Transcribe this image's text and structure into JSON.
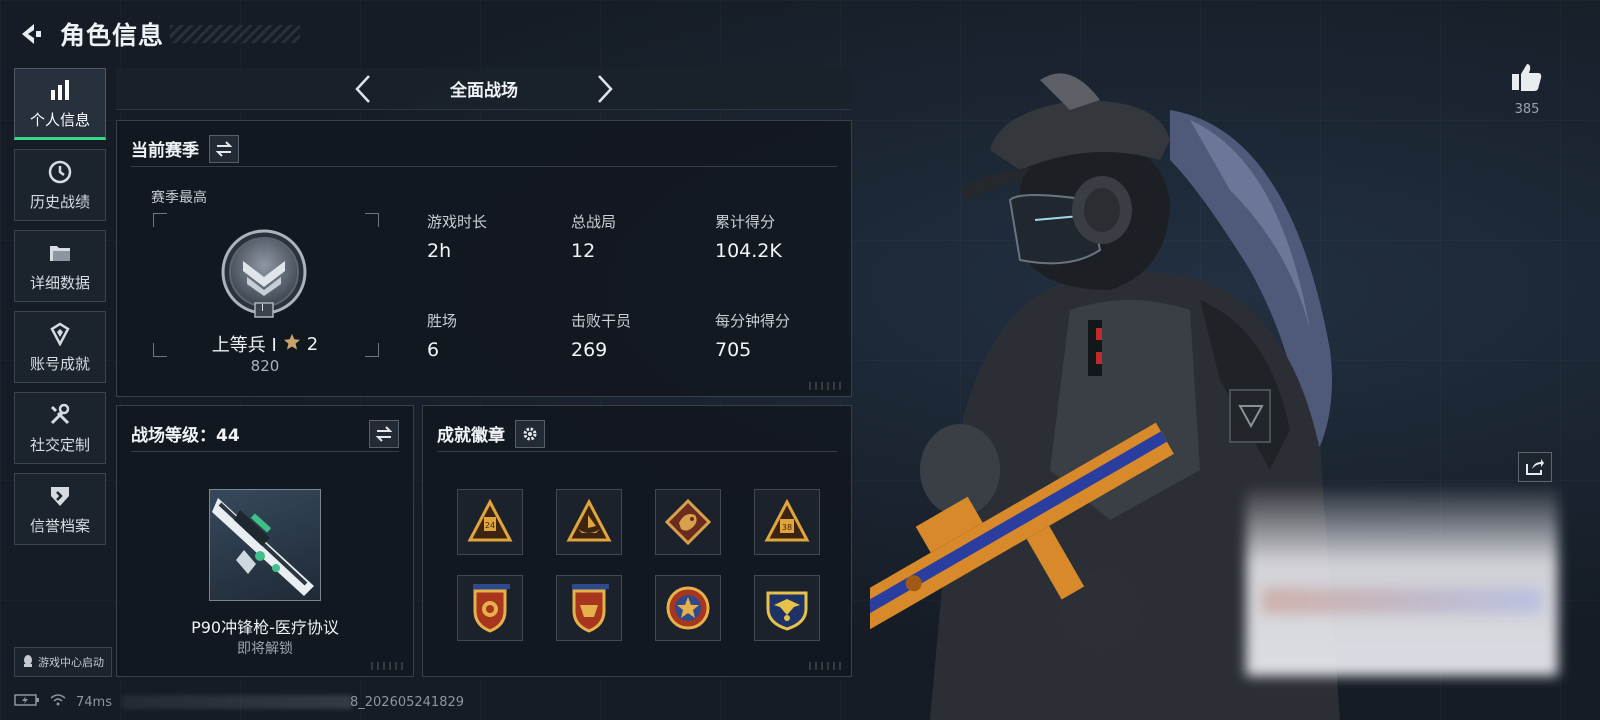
{
  "header": {
    "title": "角色信息"
  },
  "sidebar": {
    "items": [
      {
        "label": "个人信息",
        "icon": "bar-chart-icon",
        "active": true
      },
      {
        "label": "历史战绩",
        "icon": "history-icon",
        "active": false
      },
      {
        "label": "详细数据",
        "icon": "folder-icon",
        "active": false
      },
      {
        "label": "账号成就",
        "icon": "achievement-icon",
        "active": false
      },
      {
        "label": "社交定制",
        "icon": "tools-icon",
        "active": false
      },
      {
        "label": "信誉档案",
        "icon": "reputation-icon",
        "active": false
      }
    ],
    "launcher_label": "游戏中心启动"
  },
  "mode_bar": {
    "title": "全面战场"
  },
  "season_panel": {
    "title": "当前赛季",
    "best_label": "赛季最高",
    "rank_name": "上等兵 I",
    "rank_stars": "2",
    "rank_score": "820",
    "emblem_numeral": "I",
    "stats": [
      {
        "label": "游戏时长",
        "value": "2h"
      },
      {
        "label": "总战局",
        "value": "12"
      },
      {
        "label": "累计得分",
        "value": "104.2K"
      },
      {
        "label": "胜场",
        "value": "6"
      },
      {
        "label": "击败干员",
        "value": "269"
      },
      {
        "label": "每分钟得分",
        "value": "705"
      }
    ]
  },
  "level_panel": {
    "title": "战场等级：44",
    "weapon_name": "P90冲锋枪-医疗协议",
    "weapon_status": "即将解锁"
  },
  "badge_panel": {
    "title": "成就徽章",
    "badges": [
      "triangle-badge-24",
      "triangle-badge-ship",
      "dragon-badge",
      "triangle-badge-38",
      "shield-badge-red",
      "shield-badge-stars",
      "star-medal-badge",
      "eagle-shield-badge"
    ]
  },
  "right": {
    "like_count": "385"
  },
  "status_bar": {
    "ping": "74ms",
    "build_suffix": "8_202605241829"
  },
  "colors": {
    "accent": "#3ad98a",
    "panel_bg": "#12181f",
    "badge_gold": "#d9a23a"
  }
}
